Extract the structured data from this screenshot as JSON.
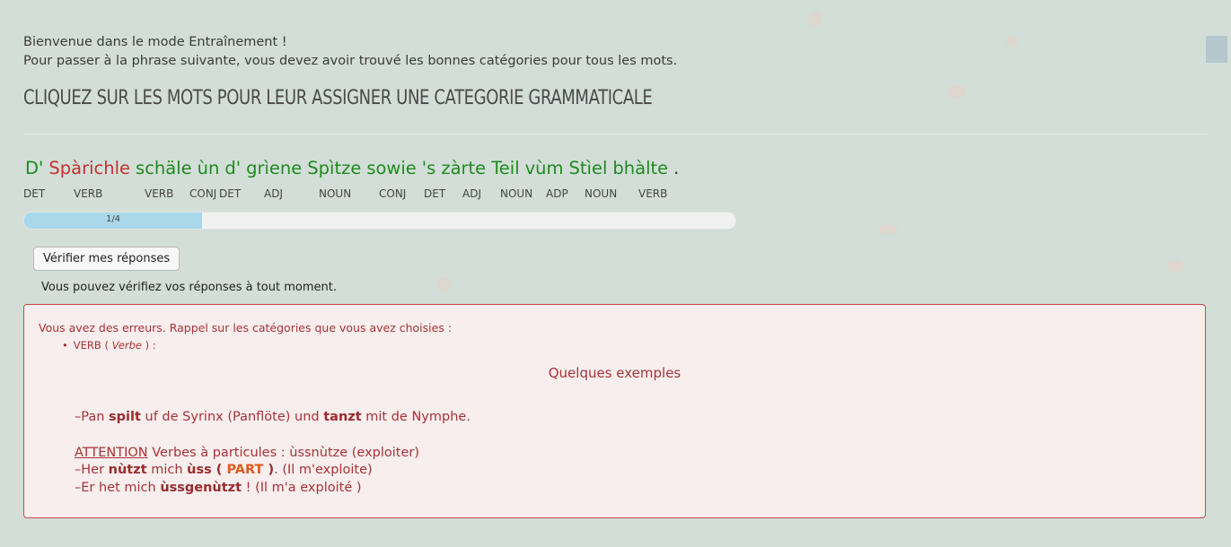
{
  "intro": {
    "line1": "Bienvenue dans le mode Entraînement !",
    "line2": "Pour passer à la phrase suivante, vous devez avoir trouvé les bonnes catégories pour tous les mots."
  },
  "title": "CLIQUEZ SUR LES MOTS POUR LEUR ASSIGNER UNE CATEGORIE GRAMMATICALE",
  "sentence": {
    "words": [
      {
        "text": "D'",
        "color": "green"
      },
      {
        "text": "Spàrichle",
        "color": "red"
      },
      {
        "text": "schäle",
        "color": "green"
      },
      {
        "text": "ùn",
        "color": "green"
      },
      {
        "text": "d'",
        "color": "green"
      },
      {
        "text": "grìene",
        "color": "green"
      },
      {
        "text": "Spìtze",
        "color": "green"
      },
      {
        "text": "sowie",
        "color": "green"
      },
      {
        "text": "'s",
        "color": "green"
      },
      {
        "text": "zàrte",
        "color": "green"
      },
      {
        "text": "Teil",
        "color": "green"
      },
      {
        "text": "vùm",
        "color": "green"
      },
      {
        "text": "Stìel",
        "color": "green"
      },
      {
        "text": "bhàlte",
        "color": "green"
      },
      {
        "text": ".",
        "color": "dark"
      }
    ],
    "tags": [
      "DET",
      "VERB",
      "VERB",
      "CONJ",
      "DET",
      "ADJ",
      "NOUN",
      "CONJ",
      "DET",
      "ADJ",
      "NOUN",
      "ADP",
      "NOUN",
      "VERB"
    ]
  },
  "progress": {
    "label": "1/4",
    "fraction": 0.25
  },
  "check_button": "Vérifier mes réponses",
  "hint": "Vous pouvez vérifiez vos réponses à tout moment.",
  "alert": {
    "heading": "Vous avez des erreurs. Rappel sur les catégories que vous avez choisies :",
    "item_tag": "VERB",
    "item_name": "Verbe",
    "examples_title": "Quelques exemples",
    "ex1": {
      "a": "–Pan ",
      "b": "spilt",
      "c": " uf de Syrinx (Panflöte) und ",
      "d": "tanzt",
      "e": " mit de Nymphe."
    },
    "ex2": {
      "att": "ATTENTION",
      "rest": " Verbes à particules : ùssnùtze (exploiter)"
    },
    "ex3": {
      "a": "–Her ",
      "b": "nùtzt",
      "c": " mich ",
      "d": "ùss",
      "e": " ( ",
      "part": "PART",
      "f": " )",
      "g": ". (Il m'exploite)"
    },
    "ex4": {
      "a": "–Er het mich ",
      "b": "ùssgenùtzt",
      "c": " ! (Il m'a exploité )"
    }
  },
  "colors": {
    "correct": "#1f8a1f",
    "error": "#c8302f",
    "progress": "#a9d8ea",
    "alert_border": "#c9474c"
  }
}
